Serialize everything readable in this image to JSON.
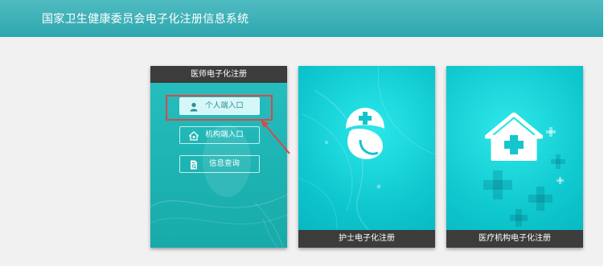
{
  "header": {
    "title": "国家卫生健康委员会电子化注册信息系统"
  },
  "cards": {
    "doctor": {
      "title": "医师电子化注册",
      "buttons": {
        "personal": "个人端入口",
        "org": "机构端入口",
        "query": "信息查询"
      }
    },
    "nurse": {
      "title": "护士电子化注册"
    },
    "institution": {
      "title": "医疗机构电子化注册"
    }
  },
  "colors": {
    "header": "#2ea6ae",
    "card_teal": "#17aaa9",
    "card_cyan": "#0fc8cf",
    "dark_bar": "#3c3c3c",
    "highlight": "#d84848"
  },
  "icons": [
    "user-icon",
    "home-icon",
    "document-search-icon",
    "nurse-cap-icon",
    "hospital-icon"
  ]
}
